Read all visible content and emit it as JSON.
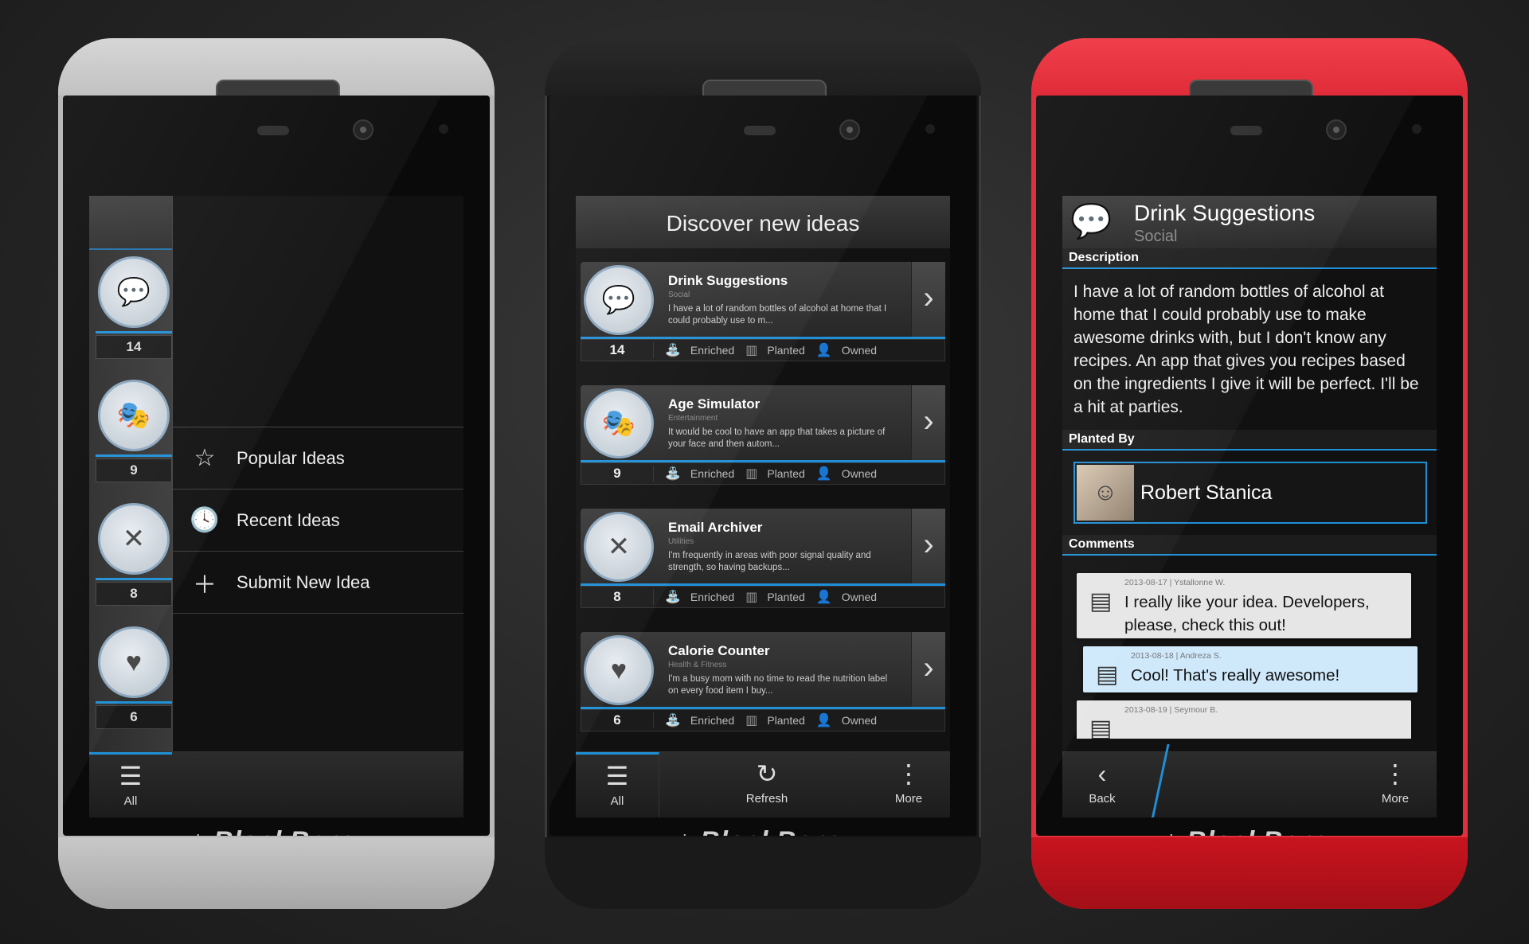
{
  "brand": "BlackBerry",
  "phone1": {
    "rail_items": [
      {
        "count": "14",
        "icon": "chat-bubbles-icon"
      },
      {
        "count": "9",
        "icon": "theater-masks-icon"
      },
      {
        "count": "8",
        "icon": "tools-icon"
      },
      {
        "count": "6",
        "icon": "heart-pulse-icon"
      }
    ],
    "menu": [
      {
        "label": "Popular Ideas",
        "icon": "star-icon"
      },
      {
        "label": "Recent Ideas",
        "icon": "clock-icon"
      },
      {
        "label": "Submit New Idea",
        "icon": "plus-icon"
      }
    ],
    "action_all": "All"
  },
  "phone2": {
    "title": "Discover new ideas",
    "ideas": [
      {
        "title": "Drink Suggestions",
        "category": "Social",
        "desc": "I have a lot of random bottles of alcohol at home that I could probably use to m...",
        "count": "14",
        "icon": "chat-bubbles-icon"
      },
      {
        "title": "Age Simulator",
        "category": "Entertainment",
        "desc": "It would be cool to have an app that takes a picture of your face and then autom...",
        "count": "9",
        "icon": "theater-masks-icon"
      },
      {
        "title": "Email Archiver",
        "category": "Utilities",
        "desc": "I'm frequently in areas with poor signal quality and strength, so having backups...",
        "count": "8",
        "icon": "tools-icon"
      },
      {
        "title": "Calorie Counter",
        "category": "Health & Fitness",
        "desc": "I'm a busy mom with no time to read the nutrition label on every food item I buy...",
        "count": "6",
        "icon": "heart-pulse-icon"
      }
    ],
    "status": {
      "enriched": "Enriched",
      "planted": "Planted",
      "owned": "Owned"
    },
    "actions": {
      "all": "All",
      "refresh": "Refresh",
      "more": "More"
    }
  },
  "phone3": {
    "title": "Drink Suggestions",
    "category": "Social",
    "description_label": "Description",
    "description": "I have a lot of random bottles of alcohol at home that I could probably use to make awesome drinks with, but I don't know any recipes. An app that gives you recipes based on the ingredients I give it will be perfect. I'll be a hit at parties.",
    "planted_by_label": "Planted By",
    "planter_name": "Robert Stanica",
    "comments_label": "Comments",
    "comments": [
      {
        "meta": "2013-08-17 | Ystallonne W.",
        "text": "I really like your idea. Developers, please, check this out!"
      },
      {
        "meta": "2013-08-18 | Andreza S.",
        "text": "Cool! That's really awesome!"
      },
      {
        "meta": "2013-08-19 | Seymour B.",
        "text": ""
      }
    ],
    "actions": {
      "back": "Back",
      "more": "More"
    }
  },
  "colors": {
    "accent": "#1f8fd6",
    "phone3_body": "#e1303c",
    "phone1_body": "#b8b8b8"
  }
}
